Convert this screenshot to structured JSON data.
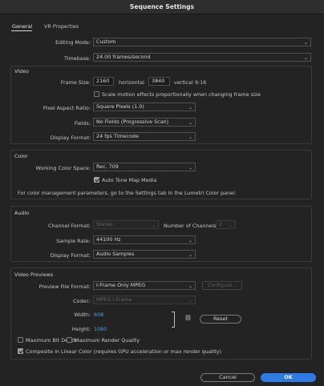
{
  "window": {
    "title": "Sequence Settings"
  },
  "tabs": [
    {
      "label": "General",
      "active": true
    },
    {
      "label": "VR Properties",
      "active": false
    }
  ],
  "general": {
    "editing_mode_label": "Editing Mode:",
    "editing_mode_value": "Custom",
    "timebase_label": "Timebase:",
    "timebase_value": "24.00  frames/second"
  },
  "video": {
    "section_title": "Video",
    "frame_size_label": "Frame Size:",
    "frame_width": "2160",
    "horizontal_label": "horizontal",
    "frame_height": "3840",
    "vertical_label": "vertical",
    "aspect": "9:16",
    "scale_motion_label": "Scale motion effects proportionally when changing frame size",
    "scale_motion_checked": false,
    "pixel_aspect_label": "Pixel Aspect Ratio:",
    "pixel_aspect_value": "Square Pixels (1.0)",
    "fields_label": "Fields:",
    "fields_value": "No Fields (Progressive Scan)",
    "display_format_label": "Display Format:",
    "display_format_value": "24 fps Timecode"
  },
  "color": {
    "section_title": "Color",
    "working_space_label": "Working Color Space:",
    "working_space_value": "Rec. 709",
    "auto_tone_label": "Auto Tone Map Media",
    "auto_tone_checked": true,
    "info_text": "For color management parameters, go to the Settings tab in the Lumetri Color panel."
  },
  "audio": {
    "section_title": "Audio",
    "channel_format_label": "Channel Format:",
    "channel_format_value": "Stereo",
    "num_channels_label": "Number of Channels:",
    "num_channels_value": "2",
    "sample_rate_label": "Sample Rate:",
    "sample_rate_value": "44100 Hz",
    "display_format_label": "Display Format:",
    "display_format_value": "Audio Samples"
  },
  "previews": {
    "section_title": "Video Previews",
    "file_format_label": "Preview File Format:",
    "file_format_value": "I-Frame Only MPEG",
    "configure_label": "Configure...",
    "codec_label": "Codec:",
    "codec_value": "MPEG I-Frame",
    "width_label": "Width:",
    "width_value": "608",
    "height_label": "Height:",
    "height_value": "1080",
    "reset_label": "Reset",
    "max_bit_depth_label": "Maximum Bit Depth",
    "max_bit_depth_checked": false,
    "max_render_label": "Maximum Render Quality",
    "max_render_checked": false,
    "composite_label": "Composite in Linear Color (requires GPU acceleration or max render quality)",
    "composite_checked": true
  },
  "footer": {
    "cancel_label": "Cancel",
    "ok_label": "OK"
  },
  "colors": {
    "accent": "#2f7be6",
    "link_value": "#4e9bf0",
    "background": "#232323"
  }
}
